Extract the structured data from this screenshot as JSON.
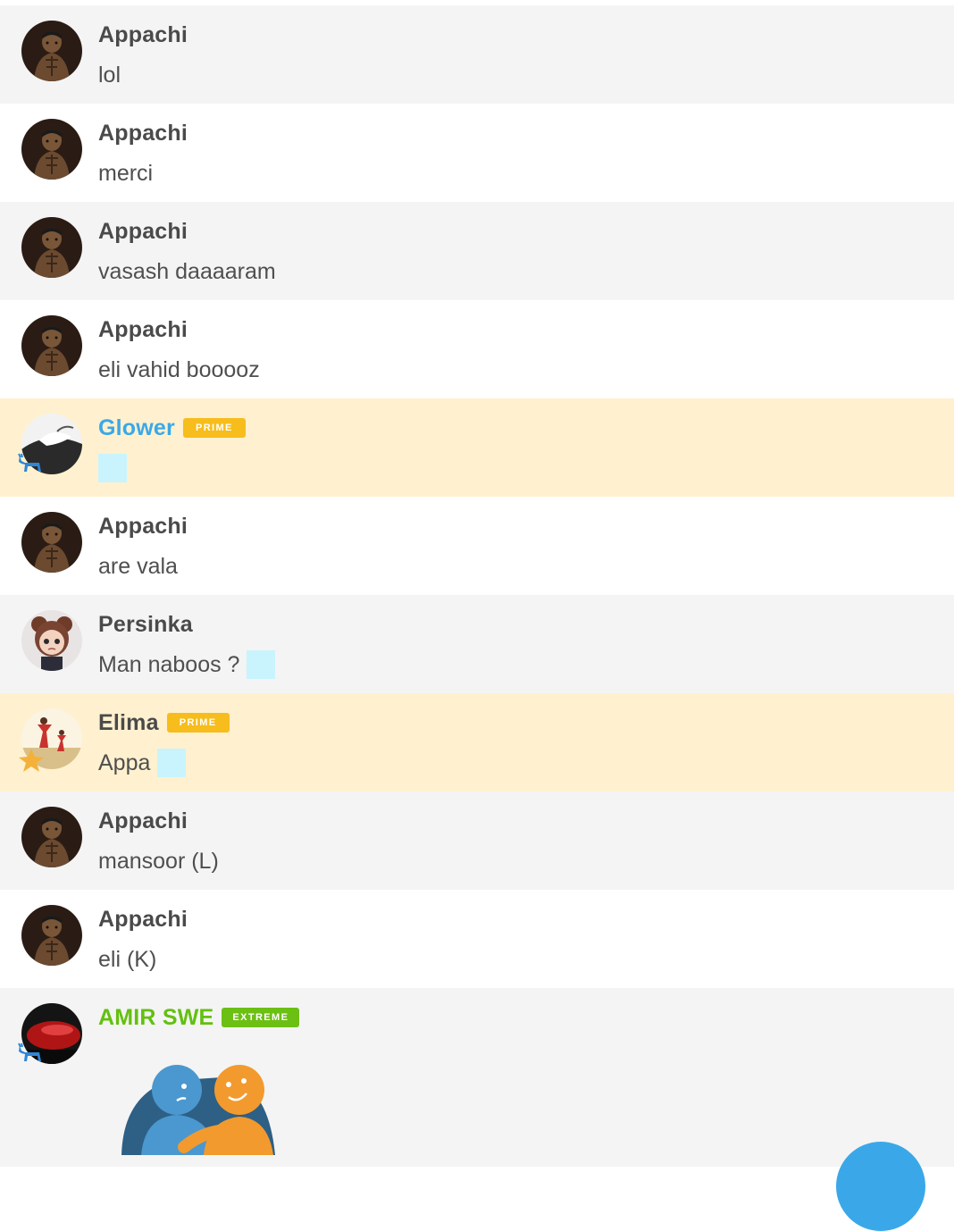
{
  "messages": [
    {
      "user": "Appachi",
      "text": "lol"
    },
    {
      "user": "Appachi",
      "text": "merci"
    },
    {
      "user": "Appachi",
      "text": "vasash daaaaram"
    },
    {
      "user": "Appachi",
      "text": "eli vahid booooz"
    },
    {
      "user": "Glower",
      "badge": "PRIME",
      "text": ""
    },
    {
      "user": "Appachi",
      "text": "are vala"
    },
    {
      "user": "Persinka",
      "text": "Man naboos ?"
    },
    {
      "user": "Elima",
      "badge": "PRIME",
      "text": "Appa"
    },
    {
      "user": "Appachi",
      "text": "mansoor (L)"
    },
    {
      "user": "Appachi",
      "text": "eli (K)"
    },
    {
      "user": "AMIR SWE",
      "badge": "EXTREME",
      "text": ""
    }
  ],
  "icons": {
    "donkey_badge": "donkey-icon",
    "star_badge": "star-icon",
    "emoji_placeholder": "emoji-icon",
    "sticker": "hug-sticker",
    "fab": "floating-action-button"
  },
  "colors": {
    "row_alt": "#f4f4f4",
    "row_highlight": "#fff1cf",
    "name_default": "#4a4a4a",
    "name_blue": "#3aa8e8",
    "name_green": "#63c00f",
    "badge_prime": "#f6bd1c",
    "badge_extreme": "#6cbf13",
    "emoji_placeholder": "#c9f4fd",
    "fab": "#3aa8e8"
  }
}
